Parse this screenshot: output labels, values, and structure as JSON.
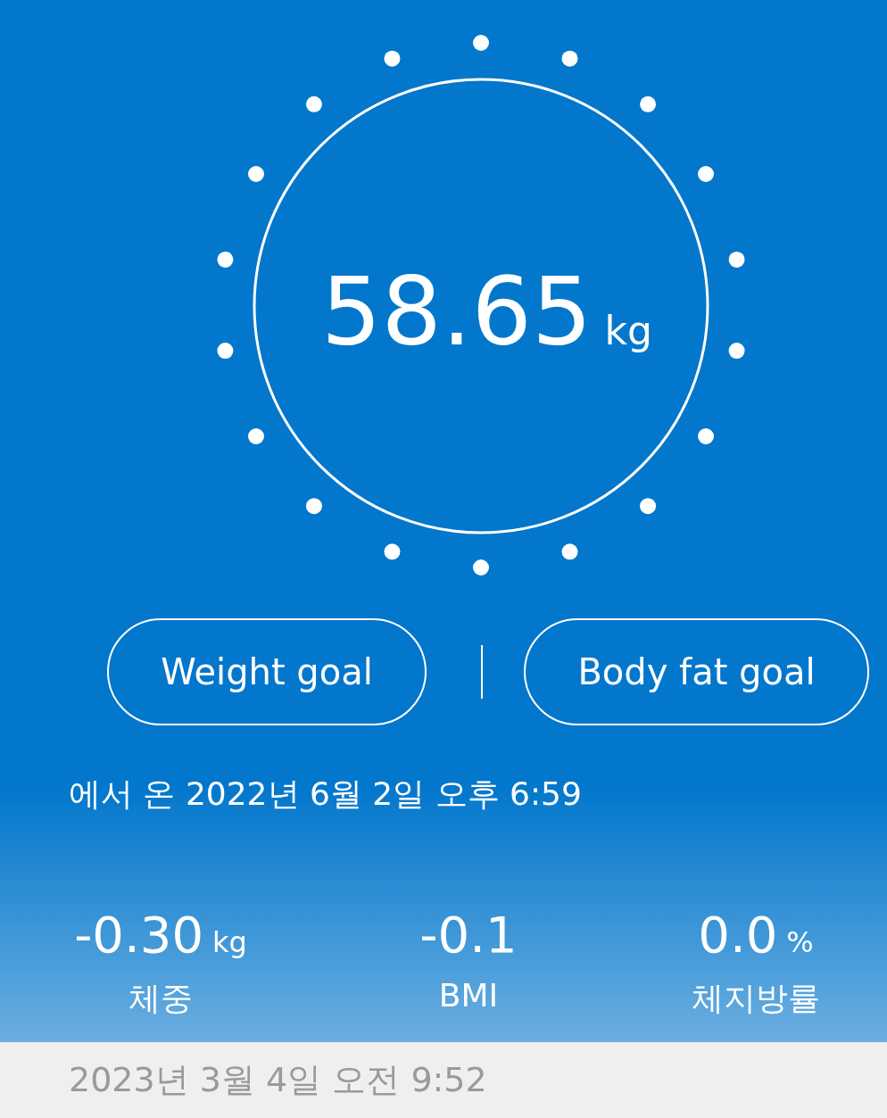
{
  "reading": {
    "value": "58.65",
    "unit": "kg"
  },
  "goal_buttons": [
    "Weight goal",
    "Body fat goal"
  ],
  "source_time": "에서 온 2022년 6월 2일 오후 6:59",
  "stats": [
    {
      "value": "-0.30",
      "unit": "kg",
      "label": "체중"
    },
    {
      "value": "-0.1",
      "label": "BMI"
    },
    {
      "value": "0.0",
      "unit": "%",
      "label": "체지방률"
    }
  ],
  "list_header": "2023년 3월 4일 오전 9:52"
}
